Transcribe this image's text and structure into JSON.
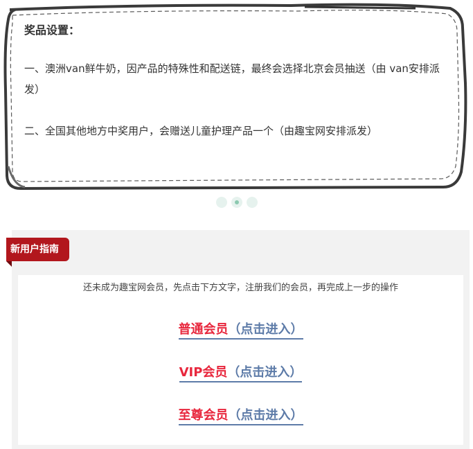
{
  "prize": {
    "title": "奖品设置：",
    "line1": "一、澳洲van鲜牛奶，因产品的特殊性和配送链，最终会选择北京会员抽送（由 van安排派发）",
    "line2": "二、全国其他地方中奖用户，会赠送儿童护理产品一个（由趣宝网安排派发）"
  },
  "carousel": {
    "dot_count": 3,
    "active_index": 1
  },
  "guide": {
    "tab_label": "新用户指南",
    "description": "还未成为趣宝网会员，先点击下方文字，注册我们的会员，再完成上一步的操作",
    "links": [
      {
        "member": "普通会员",
        "enter": "（点击进入）"
      },
      {
        "member": "VIP会员",
        "enter": "（点击进入）"
      },
      {
        "member": "至尊会员",
        "enter": "（点击进入）"
      }
    ]
  },
  "colors": {
    "accent_red": "#e8273d",
    "link_blue": "#5d7ba8",
    "tab_red": "#b2171d"
  }
}
